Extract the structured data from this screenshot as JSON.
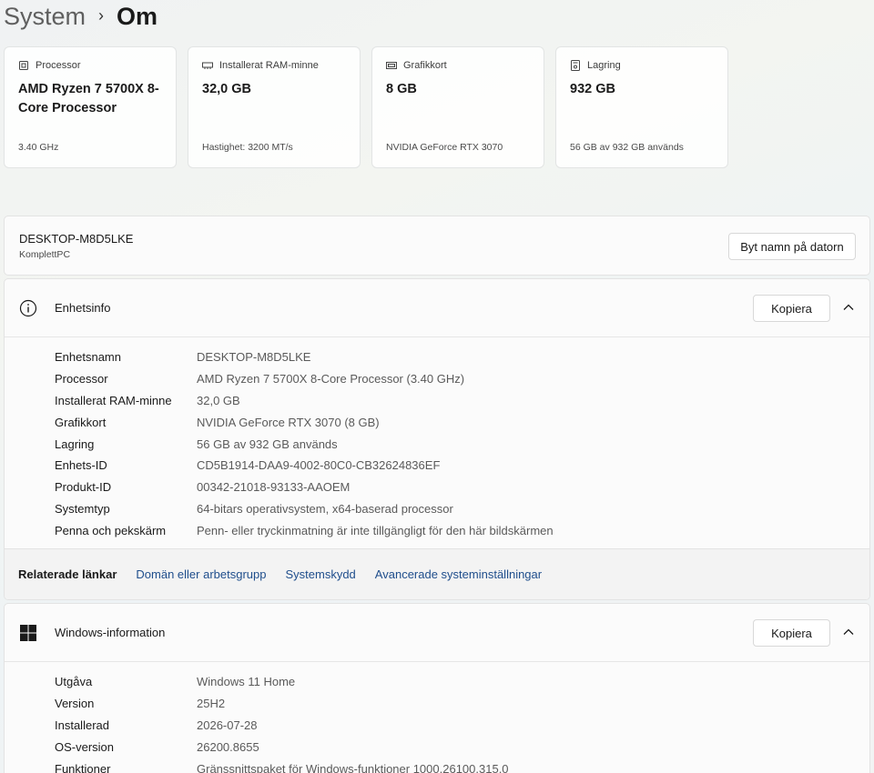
{
  "breadcrumb": {
    "parent": "System",
    "separator": "›",
    "current": "Om"
  },
  "spec_cards": [
    {
      "icon": "processor-icon",
      "label": "Processor",
      "value": "AMD Ryzen 7 5700X 8-Core Processor",
      "sub": "3.40 GHz"
    },
    {
      "icon": "ram-icon",
      "label": "Installerat RAM-minne",
      "value": "32,0 GB",
      "sub": "Hastighet: 3200 MT/s"
    },
    {
      "icon": "graphics-card-icon",
      "label": "Grafikkort",
      "value": "8 GB",
      "sub": "NVIDIA GeForce RTX 3070"
    },
    {
      "icon": "storage-icon",
      "label": "Lagring",
      "value": "932 GB",
      "sub": "56 GB av 932 GB används"
    }
  ],
  "pc": {
    "name": "DESKTOP-M8D5LKE",
    "model": "KomplettPC",
    "rename_label": "Byt namn på datorn"
  },
  "device_info": {
    "title": "Enhetsinfo",
    "copy_label": "Kopiera",
    "rows": [
      {
        "label": "Enhetsnamn",
        "value": "DESKTOP-M8D5LKE"
      },
      {
        "label": "Processor",
        "value": "AMD Ryzen 7 5700X 8-Core Processor (3.40 GHz)"
      },
      {
        "label": "Installerat RAM-minne",
        "value": "32,0 GB"
      },
      {
        "label": "Grafikkort",
        "value": "NVIDIA GeForce RTX 3070 (8 GB)"
      },
      {
        "label": "Lagring",
        "value": "56 GB av 932 GB används"
      },
      {
        "label": "Enhets-ID",
        "value": "CD5B1914-DAA9-4002-80C0-CB32624836EF"
      },
      {
        "label": "Produkt-ID",
        "value": "00342-21018-93133-AAOEM"
      },
      {
        "label": "Systemtyp",
        "value": "64-bitars operativsystem, x64-baserad processor"
      },
      {
        "label": "Penna och pekskärm",
        "value": "Penn- eller tryckinmatning är inte tillgängligt för den här bildskärmen"
      }
    ]
  },
  "related_links": {
    "title": "Relaterade länkar",
    "links": [
      "Domän eller arbetsgrupp",
      "Systemskydd",
      "Avancerade systeminställningar"
    ]
  },
  "windows_info": {
    "title": "Windows-information",
    "copy_label": "Kopiera",
    "rows": [
      {
        "label": "Utgåva",
        "value": "Windows 11 Home"
      },
      {
        "label": "Version",
        "value": "25H2"
      },
      {
        "label": "Installerad",
        "value": "2026-07-28"
      },
      {
        "label": "OS-version",
        "value": "26200.8655"
      },
      {
        "label": "Funktioner",
        "value": "Gränssnittspaket för Windows-funktioner 1000.26100.315.0"
      }
    ]
  },
  "colors": {
    "link": "#1f4e8c",
    "windows_logo": "#1a1a1a"
  }
}
